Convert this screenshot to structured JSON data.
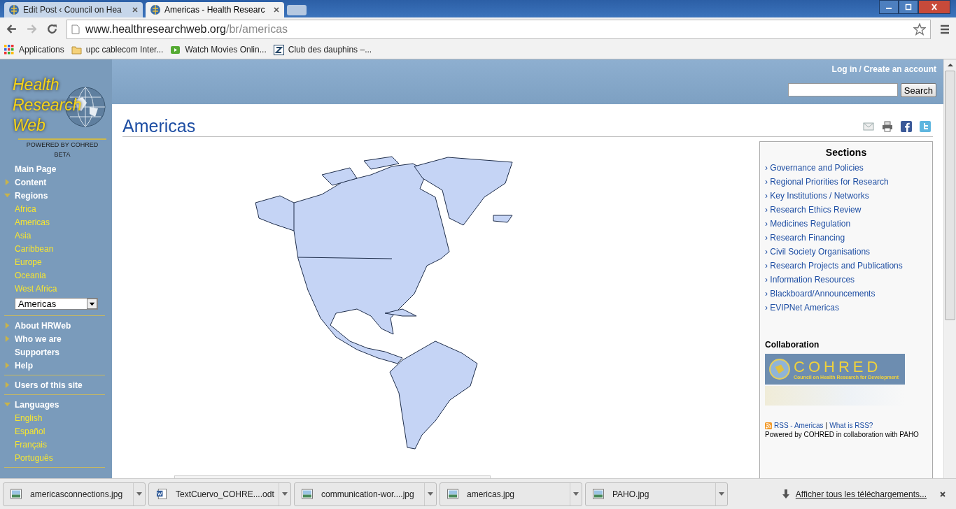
{
  "browser": {
    "tabs": [
      {
        "title": "Edit Post ‹ Council on Hea",
        "selected": false
      },
      {
        "title": "Americas - Health Researc",
        "selected": true
      }
    ],
    "address": {
      "host": "www.healthresearchweb.org",
      "path": "/br/americas"
    },
    "bookmarks": [
      {
        "label": "Applications",
        "kind": "apps"
      },
      {
        "label": "upc cablecom Inter...",
        "kind": "folder"
      },
      {
        "label": "Watch Movies Onlin...",
        "kind": "video"
      },
      {
        "label": "Club des dauphins –...",
        "kind": "letter"
      }
    ]
  },
  "site": {
    "logo": {
      "lines": [
        "Health",
        "Research",
        "Web"
      ],
      "tagline": "POWERED BY COHRED",
      "badge": "BETA"
    },
    "header": {
      "login": "Log in",
      "separator": "/",
      "create": "Create an account",
      "search_button": "Search"
    },
    "nav": [
      [
        {
          "label": "Main Page",
          "kind": "section"
        },
        {
          "label": "Content",
          "kind": "section",
          "expanded": false
        },
        {
          "label": "Regions",
          "kind": "section",
          "expanded": true
        },
        {
          "label": "Africa",
          "kind": "link"
        },
        {
          "label": "Americas",
          "kind": "link"
        },
        {
          "label": "Asia",
          "kind": "link"
        },
        {
          "label": "Caribbean",
          "kind": "link"
        },
        {
          "label": "Europe",
          "kind": "link"
        },
        {
          "label": "Oceania",
          "kind": "link"
        },
        {
          "label": "West Africa",
          "kind": "link"
        },
        {
          "label": "Americas",
          "kind": "select"
        }
      ],
      [
        {
          "label": "About HRWeb",
          "kind": "section",
          "expanded": false
        },
        {
          "label": "Who we are",
          "kind": "section",
          "expanded": false
        },
        {
          "label": "Supporters",
          "kind": "section"
        },
        {
          "label": "Help",
          "kind": "section",
          "expanded": false
        }
      ],
      [
        {
          "label": "Users of this site",
          "kind": "section",
          "expanded": false
        }
      ],
      [
        {
          "label": "Languages",
          "kind": "section",
          "expanded": true
        },
        {
          "label": "English",
          "kind": "link"
        },
        {
          "label": "Español",
          "kind": "link"
        },
        {
          "label": "Français",
          "kind": "link"
        },
        {
          "label": "Português",
          "kind": "link"
        }
      ]
    ],
    "page_title": "Americas",
    "sections": {
      "title": "Sections",
      "links": [
        "› Governance and Policies",
        "› Regional Priorities for Research",
        "› Key Institutions / Networks",
        "› Research Ethics Review",
        "› Medicines Regulation",
        "› Research Financing",
        "› Civil Society Organisations",
        "› Research Projects and Publications",
        "› Information Resources",
        "› Blackboard/Announcements",
        "› EVIPNet Americas"
      ]
    },
    "collaboration": {
      "title": "Collaboration",
      "cohred": "COHRED",
      "cohred_sub": "Council on Health Research for Development",
      "rss": "RSS - Americas",
      "rss_sep": "|",
      "rss_help": "What is RSS?",
      "powered": "Powered by COHRED in collaboration with PAHO"
    }
  },
  "downloads": {
    "items": [
      {
        "name": "americasconnections.jpg",
        "kind": "image"
      },
      {
        "name": "TextCuervo_COHRE....odt",
        "kind": "document"
      },
      {
        "name": "communication-wor....jpg",
        "kind": "image"
      },
      {
        "name": "americas.jpg",
        "kind": "image"
      },
      {
        "name": "PAHO.jpg",
        "kind": "image"
      }
    ],
    "show_all": "Afficher tous les téléchargements..."
  }
}
